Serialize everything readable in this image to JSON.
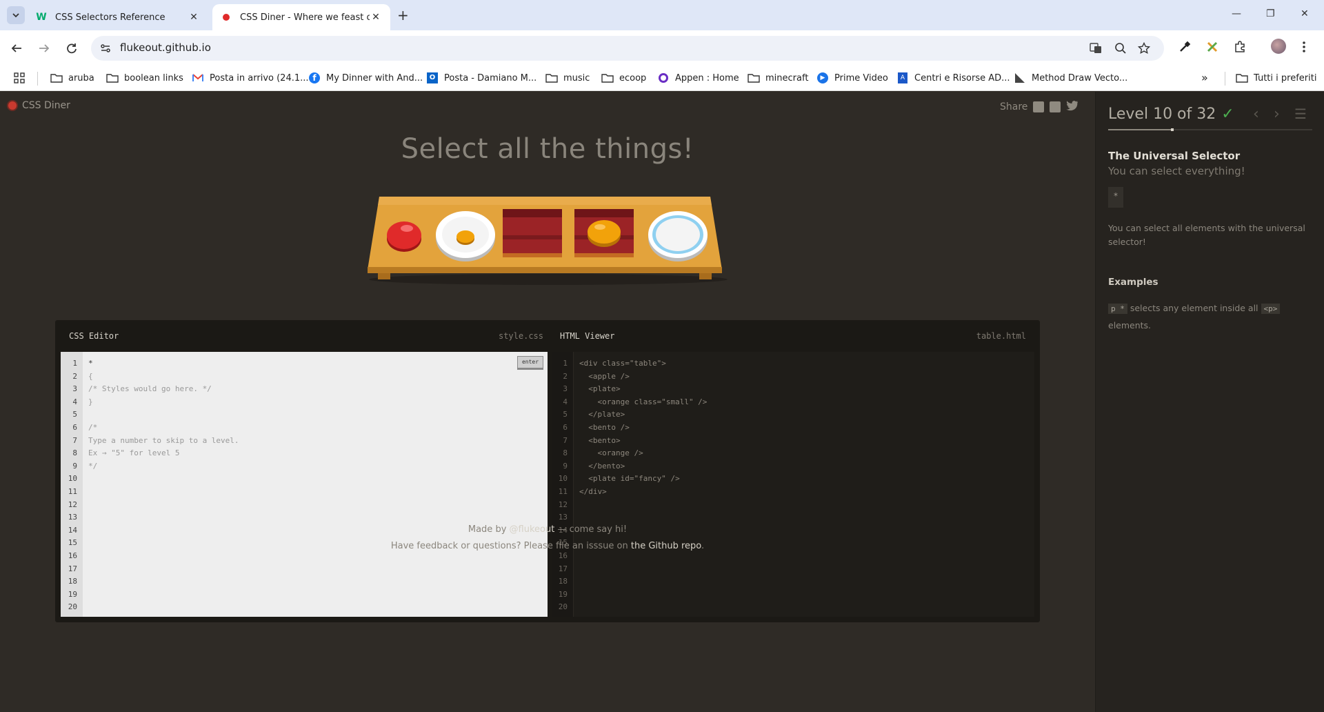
{
  "browser": {
    "tabs": [
      {
        "title": "CSS Selectors Reference",
        "close": "✕"
      },
      {
        "title": "CSS Diner - Where we feast on",
        "close": "✕"
      }
    ],
    "new_tab": "+",
    "window_controls": {
      "minimize": "—",
      "restore": "❐",
      "close": "✕"
    },
    "url": "flukeout.github.io",
    "bookmarks": [
      {
        "label": "aruba",
        "icon": "folder-icon"
      },
      {
        "label": "boolean links",
        "icon": "folder-icon"
      },
      {
        "label": "Posta in arrivo (24.1...",
        "icon": "gmail-icon"
      },
      {
        "label": "My Dinner with And...",
        "icon": "facebook-icon"
      },
      {
        "label": "Posta - Damiano M...",
        "icon": "outlook-icon"
      },
      {
        "label": "music",
        "icon": "folder-icon"
      },
      {
        "label": "ecoop",
        "icon": "folder-icon"
      },
      {
        "label": "Appen : Home",
        "icon": "appen-icon"
      },
      {
        "label": "minecraft",
        "icon": "folder-icon"
      },
      {
        "label": "Prime Video",
        "icon": "prime-icon"
      },
      {
        "label": "Centri e Risorse AD...",
        "icon": "adobe-icon"
      },
      {
        "label": "Method Draw Vecto...",
        "icon": "method-icon"
      }
    ],
    "bookmarks_more": "»",
    "all_bookmarks": "Tutti i preferiti"
  },
  "game": {
    "logo": "CSS Diner",
    "share": "Share",
    "order": "Select all the things!",
    "css_editor": {
      "title": "CSS Editor",
      "filename": "style.css",
      "enter": "enter",
      "lines": [
        "*",
        "{",
        "/* Styles would go here. */",
        "}",
        "",
        "/*",
        "Type a number to skip to a level.",
        "Ex → \"5\" for level 5",
        "*/"
      ]
    },
    "html_viewer": {
      "title": "HTML Viewer",
      "filename": "table.html",
      "lines": [
        "<div class=\"table\">",
        "  <apple />",
        "  <plate>",
        "    <orange class=\"small\" />",
        "  </plate>",
        "  <bento />",
        "  <bento>",
        "    <orange />",
        "  </bento>",
        "  <plate id=\"fancy\" />",
        "</div>"
      ]
    },
    "line_numbers": [
      "1",
      "2",
      "3",
      "4",
      "5",
      "6",
      "7",
      "8",
      "9",
      "10",
      "11",
      "12",
      "13",
      "14",
      "15",
      "16",
      "17",
      "18",
      "19",
      "20"
    ],
    "footer": {
      "made_by_prefix": "Made by ",
      "made_by_link": "@flukeout",
      "made_by_suffix": " — come say hi!",
      "feedback_prefix": "Have feedback or questions? Please file an isssue on ",
      "feedback_link": "the Github repo",
      "feedback_suffix": "."
    }
  },
  "sidebar": {
    "level": "Level 10 of 32",
    "level_progress": 0.3125,
    "completed_mark": "✓",
    "prev": "‹",
    "next": "›",
    "menu": "☰",
    "selector_name": "The Universal Selector",
    "title": "You can select everything!",
    "syntax": "*",
    "hint": "You can select all elements with the universal selector!",
    "examples_title": "Examples",
    "example": {
      "code": "p *",
      "text": " selects any element inside all ",
      "code2": "<p>",
      "tail": " elements."
    }
  },
  "colors": {
    "page_bg": "#2f2b26",
    "sidebar_bg": "#26231f",
    "table": "#e3a33c",
    "apple": "#e02a2a",
    "orange": "#f2a20a",
    "bento": "#9b2326",
    "plate_fancy_ring": "#8fd0f0",
    "check": "#4caf50"
  }
}
